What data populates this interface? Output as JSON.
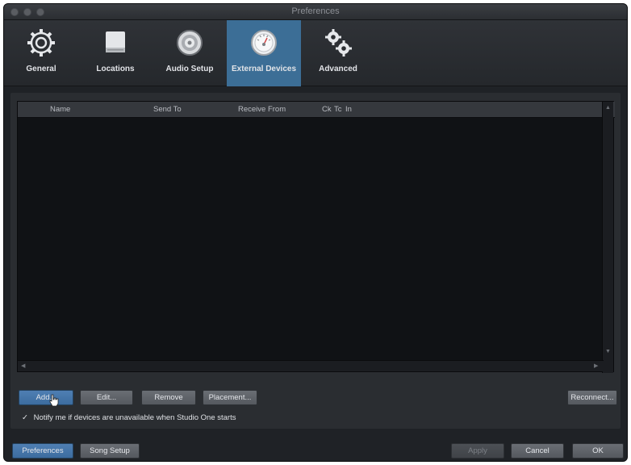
{
  "window": {
    "title": "Preferences"
  },
  "tabs": [
    {
      "label": "General",
      "icon": "gear-icon"
    },
    {
      "label": "Locations",
      "icon": "drive-icon"
    },
    {
      "label": "Audio Setup",
      "icon": "speaker-icon"
    },
    {
      "label": "External Devices",
      "icon": "meter-icon",
      "active": true
    },
    {
      "label": "Advanced",
      "icon": "gears-icon"
    }
  ],
  "table": {
    "columns": [
      "Name",
      "Send To",
      "Receive From",
      "Ck",
      "Tc",
      "In"
    ]
  },
  "actions": {
    "add": "Add...",
    "edit": "Edit...",
    "remove": "Remove",
    "placement": "Placement...",
    "reconnect": "Reconnect..."
  },
  "notify": {
    "label": "Notify me if devices are unavailable when Studio One starts",
    "checked": true,
    "check_mark": "✓"
  },
  "footer": {
    "preferences": "Preferences",
    "song_setup": "Song Setup",
    "apply": "Apply",
    "cancel": "Cancel",
    "ok": "OK"
  },
  "colors": {
    "active_tab": "#3c6e96",
    "window_bg": "#1f2226",
    "blue_button": "#4577ac"
  }
}
